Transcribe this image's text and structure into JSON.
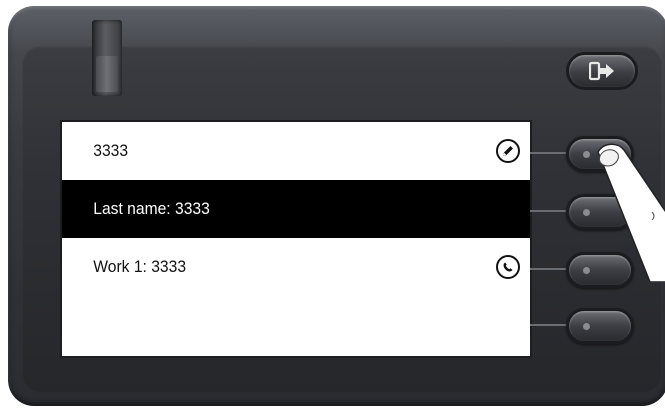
{
  "display": {
    "rows": [
      {
        "label": "3333",
        "icon": "pencil-edit-icon",
        "selected": false
      },
      {
        "label": "Last name: 3333",
        "icon": "",
        "selected": true
      },
      {
        "label": "Work 1: 3333",
        "icon": "phone-call-icon",
        "selected": false
      },
      {
        "label": "",
        "icon": "",
        "selected": false
      }
    ]
  },
  "hardware": {
    "exit_icon": "exit-arrow-icon",
    "line_keys": 4
  },
  "colors": {
    "screen_bg": "#ffffff",
    "selection_bg": "#000000",
    "selection_text": "#ffffff",
    "device_body": "#2f3136"
  }
}
